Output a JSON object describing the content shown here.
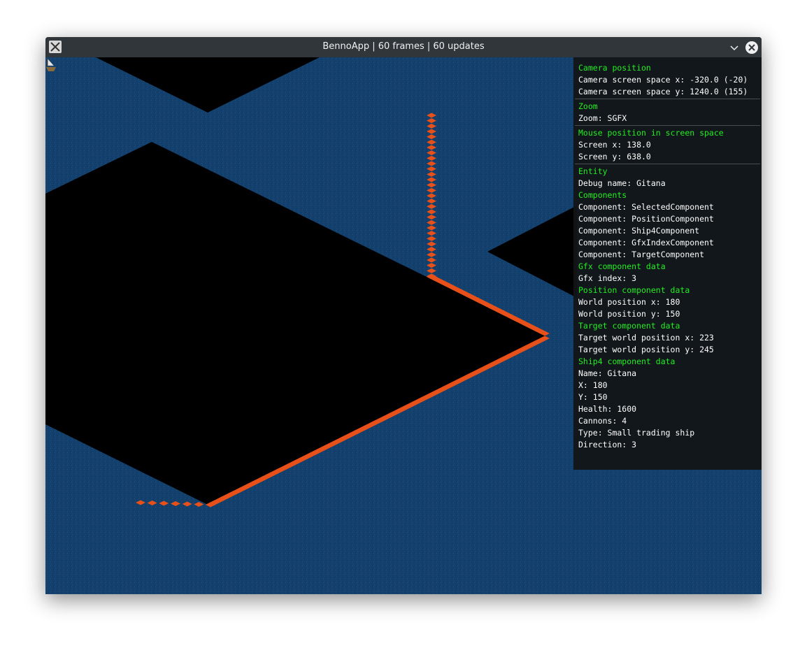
{
  "window": {
    "title": "BennoApp | 60 frames | 60 updates"
  },
  "icons": {
    "app": "x11-app-icon",
    "minimize": "chevron-down-icon",
    "close": "close-icon"
  },
  "colors": {
    "water": "#13406c",
    "island": "#000000",
    "path": "#e8501a",
    "header_text": "#22ee22",
    "text": "#ffffff",
    "panel_bg": "#121416"
  },
  "debug": {
    "camera": {
      "header": "Camera position",
      "x": "Camera screen space x: -320.0 (-20)",
      "y": "Camera screen space y: 1240.0 (155)"
    },
    "zoom": {
      "header": "Zoom",
      "value": "Zoom: SGFX"
    },
    "mouse": {
      "header": "Mouse position in screen space",
      "x": "Screen x: 138.0",
      "y": "Screen y: 638.0"
    },
    "entity": {
      "header": "Entity",
      "debug_name": "Debug name: Gitana",
      "components_header": "Components",
      "components": [
        "Component: SelectedComponent",
        "Component: PositionComponent",
        "Component: Ship4Component",
        "Component: GfxIndexComponent",
        "Component: TargetComponent"
      ],
      "gfx_header": "Gfx component data",
      "gfx_index": "Gfx index: 3",
      "position_header": "Position component data",
      "world_x": "World position x: 180",
      "world_y": "World position y: 150",
      "target_header": "Target component data",
      "target_x": "Target world position x: 223",
      "target_y": "Target world position y: 245",
      "ship_header": "Ship4 component data",
      "ship": [
        "Name: Gitana",
        "X: 180",
        "Y: 150",
        "Health: 1600",
        "Cannons: 4",
        "Type: Small trading ship",
        "Direction: 3"
      ]
    }
  }
}
